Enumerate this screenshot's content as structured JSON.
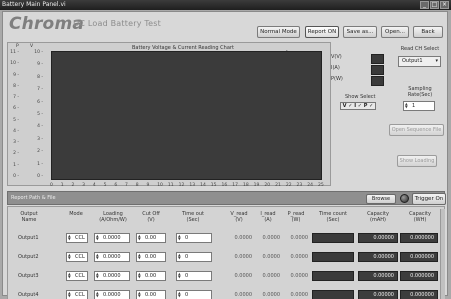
{
  "window": {
    "title": "Battery Main Panel.vi",
    "controls": [
      "min-icon",
      "max-icon",
      "close-icon"
    ]
  },
  "header": {
    "logo": "Chroma",
    "title": "DC Load Battery Test",
    "buttons": {
      "normal_mode": "Normal Mode",
      "report_on": "Report ON",
      "save_as": "Save as...",
      "open": "Open...",
      "back": "Back"
    }
  },
  "chart": {
    "title": "Battery  Voltage & Current Reading Chart",
    "p_label": "P",
    "v_label": "V",
    "x_unit": "(Sec)",
    "y_ticks": [
      "10 -",
      "9 -",
      "8 -",
      "7 -",
      "6 -",
      "5 -",
      "4 -",
      "3 -",
      "2 -",
      "1 -",
      "0 -"
    ],
    "y_left_ticks": [
      "11 -",
      "10 -",
      "9 -",
      "8 -",
      "7 -",
      "6 -",
      "5 -",
      "4 -",
      "3 -",
      "2 -",
      "1 -",
      "0 -"
    ],
    "x_ticks": [
      "0",
      "1",
      "2",
      "3",
      "4",
      "5",
      "6",
      "7",
      "8",
      "9",
      "10",
      "11",
      "12",
      "13",
      "14",
      "15",
      "16",
      "17",
      "18",
      "19",
      "20",
      "21",
      "22",
      "23",
      "24",
      "25"
    ],
    "right_marks": [
      "-1",
      "-1",
      "-0"
    ]
  },
  "legend": {
    "items": [
      "V(V)",
      "I(A)",
      "P(W)"
    ],
    "show_select_label": "Show Select",
    "show_select_value": "V ✓ I ✓ P ✓"
  },
  "controls": {
    "read_ch_label": "Read CH Select",
    "read_ch_value": "Output1",
    "sampling_label_1": "Sampling",
    "sampling_label_2": "Rate(Sec)",
    "sampling_value": "1",
    "open_sequence_button": "Open Sequence File",
    "show_loading_button": "Show Loading"
  },
  "path": {
    "label": "Report Path & File",
    "browse_button": "Browse",
    "trigger_button": "Trigger On"
  },
  "table": {
    "headers": {
      "output": [
        "Output",
        "Name"
      ],
      "mode": [
        "Mode"
      ],
      "loading": [
        "Loading",
        "(A/Ohm/W)"
      ],
      "cutoff": [
        "Cut Off",
        "(V)"
      ],
      "timeout": [
        "Time out",
        "(Sec)"
      ],
      "v_read": [
        "V_read",
        "(V)"
      ],
      "i_read": [
        "I_read",
        "(A)"
      ],
      "p_read": [
        "P_read",
        "(W)"
      ],
      "time_count": [
        "Time count",
        "(Sec)"
      ],
      "cap_mah": [
        "Capacity",
        "(mAH)"
      ],
      "cap_wh": [
        "Capacity",
        "(WH)"
      ]
    },
    "rows": [
      {
        "name": "Output1",
        "mode": "CCL",
        "loading": "0.0000",
        "cutoff": "0.00",
        "timeout": "0",
        "v": "0.0000",
        "i": "0.0000",
        "p": "0.0000",
        "cap_mah": "0.00000",
        "cap_wh": "0.000000"
      },
      {
        "name": "Output2",
        "mode": "CCL",
        "loading": "0.0000",
        "cutoff": "0.00",
        "timeout": "0",
        "v": "0.0000",
        "i": "0.0000",
        "p": "0.0000",
        "cap_mah": "0.00000",
        "cap_wh": "0.000000"
      },
      {
        "name": "Output3",
        "mode": "CCL",
        "loading": "0.0000",
        "cutoff": "0.00",
        "timeout": "0",
        "v": "0.0000",
        "i": "0.0000",
        "p": "0.0000",
        "cap_mah": "0.00000",
        "cap_wh": "0.000000"
      },
      {
        "name": "Output4",
        "mode": "CCL",
        "loading": "0.0000",
        "cutoff": "0.00",
        "timeout": "0",
        "v": "0.0000",
        "i": "0.0000",
        "p": "0.0000",
        "cap_mah": "0.00000",
        "cap_wh": "0.000000"
      }
    ]
  }
}
